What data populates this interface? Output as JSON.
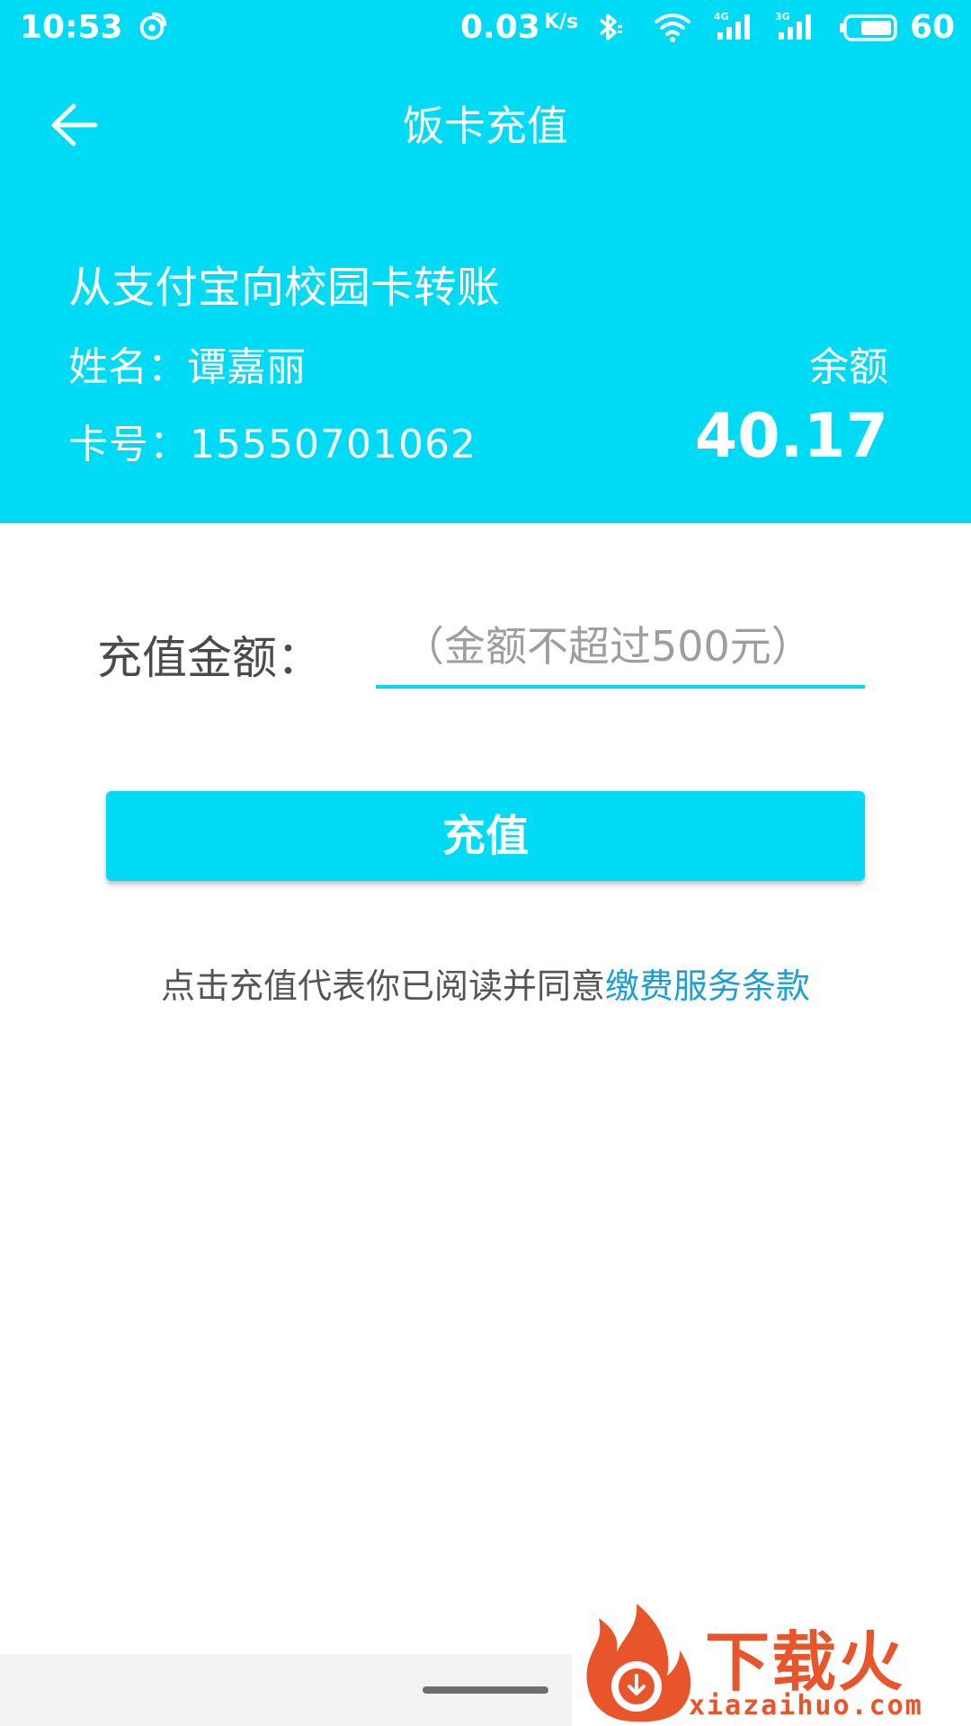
{
  "status_bar": {
    "time": "10:53",
    "net_speed": "0.03",
    "net_unit": "K/s",
    "network_1": "4G",
    "network_2": "3G",
    "battery": "60"
  },
  "app_bar": {
    "title": "饭卡充值"
  },
  "card_info": {
    "transfer_title": "从支付宝向校园卡转账",
    "name_label": "姓名：",
    "name_value": "谭嘉丽",
    "card_label": "卡号：",
    "card_value": "15550701062",
    "balance_label": "余额",
    "balance_value": "40.17"
  },
  "form": {
    "amount_label": "充值金额：",
    "amount_placeholder": "（金额不超过500元）",
    "recharge_label": "充值"
  },
  "terms": {
    "prefix": "点击充值代表你已阅读并同意",
    "link": "缴费服务条款"
  },
  "watermark": {
    "brand": "下载火",
    "url": "xiazaihuo.com"
  },
  "colors": {
    "accent": "#00dbf5",
    "link": "#1a9fd6",
    "watermark": "#e9552a"
  }
}
